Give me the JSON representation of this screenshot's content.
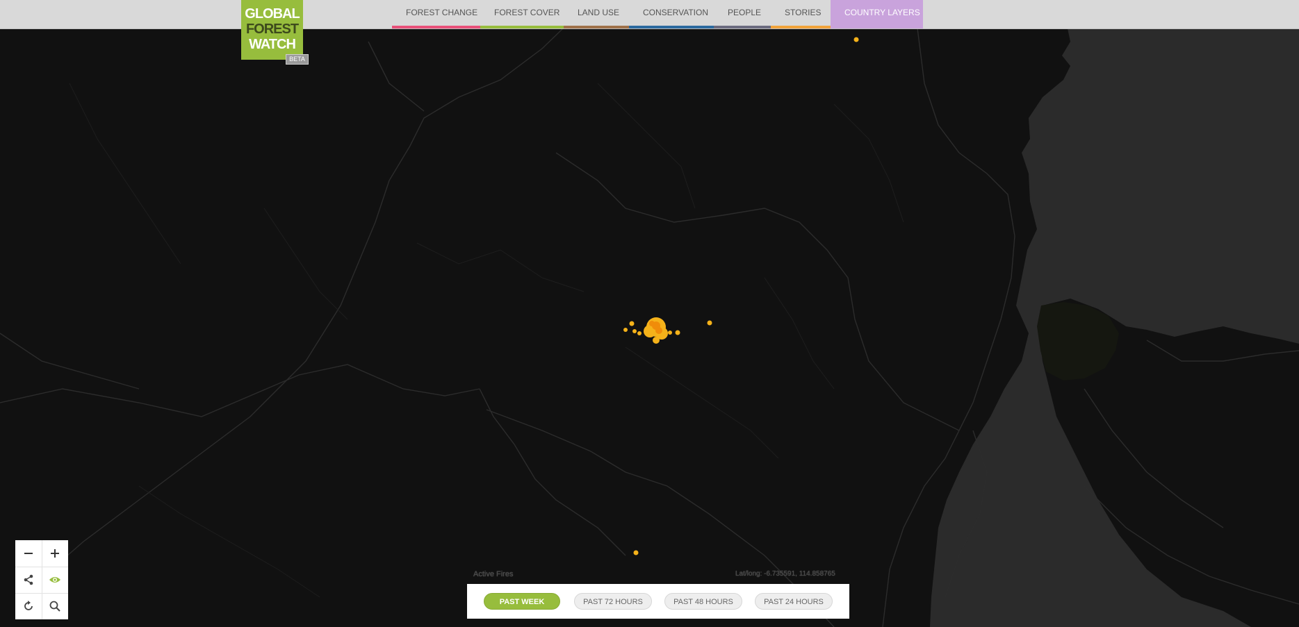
{
  "logo": {
    "line1": "GLOBAL",
    "line2": "FOREST",
    "line3": "WATCH",
    "badge": "BETA"
  },
  "nav": [
    {
      "label": "FOREST CHANGE",
      "color": "#e8517a"
    },
    {
      "label": "FOREST COVER",
      "color": "#97bd3d"
    },
    {
      "label": "LAND USE",
      "color": "#a0724a"
    },
    {
      "label": "CONSERVATION",
      "color": "#2c6aa0"
    },
    {
      "label": "PEOPLE",
      "color": "#6b6b7f"
    },
    {
      "label": "STORIES",
      "color": "#f1a33b"
    },
    {
      "label": "COUNTRY LAYERS",
      "color": "#c9a3dc"
    }
  ],
  "map_controls": {
    "zoom_out_icon": "minus-icon",
    "zoom_in_icon": "plus-icon",
    "share_icon": "share-icon",
    "view_icon": "eye-icon",
    "reset_icon": "refresh-icon",
    "search_icon": "search-icon"
  },
  "legend": {
    "title": "Active Fires"
  },
  "coordinates": {
    "text": "Lat/long: -6.735591, 114.858765"
  },
  "time_filter": {
    "options": [
      "PAST WEEK",
      "PAST 72 HOURS",
      "PAST 48 HOURS",
      "PAST 24 HOURS"
    ],
    "selected": "PAST WEEK"
  },
  "colors": {
    "brand_green": "#97bd3d",
    "map_background": "#111111",
    "sea": "#2b2b2b",
    "fire": "#f5b21a",
    "fire_core": "#f08c0a"
  }
}
